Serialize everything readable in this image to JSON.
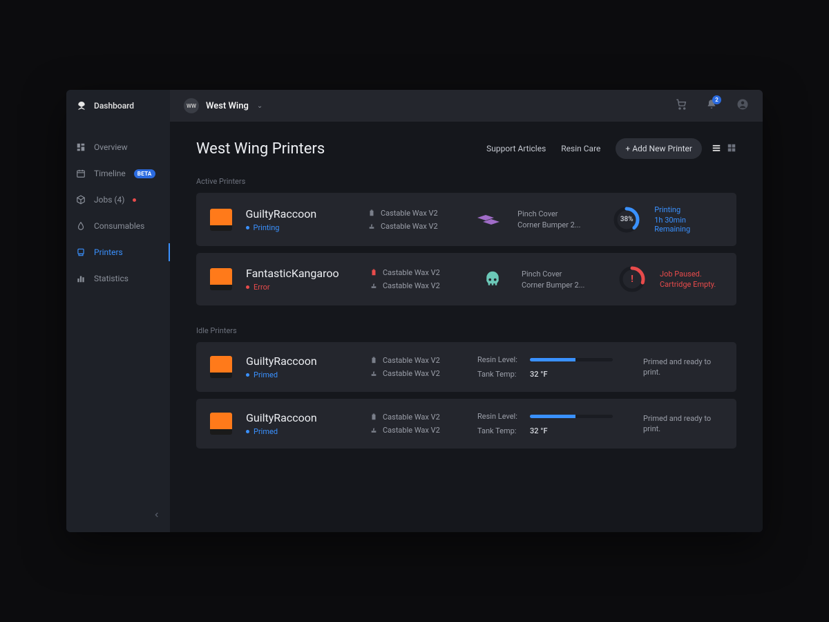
{
  "sidebar": {
    "title": "Dashboard",
    "items": [
      {
        "label": "Overview"
      },
      {
        "label": "Timeline",
        "badge": "BETA"
      },
      {
        "label": "Jobs (4)",
        "dot": true
      },
      {
        "label": "Consumables"
      },
      {
        "label": "Printers"
      },
      {
        "label": "Statistics"
      }
    ]
  },
  "topbar": {
    "org_initials": "WW",
    "org_name": "West Wing",
    "notif_count": "2"
  },
  "header": {
    "title": "West Wing Printers",
    "links": {
      "support": "Support Articles",
      "care": "Resin Care"
    },
    "add_btn": "+ Add New Printer"
  },
  "sections": {
    "active_label": "Active Printers",
    "idle_label": "Idle Printers"
  },
  "active": [
    {
      "name": "GuiltyRaccoon",
      "status": "Printing",
      "status_class": "printing",
      "mat1": "Castable Wax V2",
      "mat2": "Castable Wax V2",
      "mat1_red": false,
      "file1": "Pinch Cover",
      "file2": "Corner Bumper 2...",
      "model_color": "#a06cc8",
      "model_type": "blocks",
      "progress_pct": 38,
      "progress_label": "38%",
      "job_l1": "Printing",
      "job_l2": "1h 30min Remaining",
      "error": false
    },
    {
      "name": "FantasticKangaroo",
      "status": "Error",
      "status_class": "error",
      "mat1": "Castable Wax V2",
      "mat2": "Castable Wax V2",
      "mat1_red": true,
      "file1": "Pinch Cover",
      "file2": "Corner Bumper 2...",
      "model_color": "#6cc8b8",
      "model_type": "skull",
      "progress_pct": 30,
      "progress_label": "!",
      "job_l1": "Job Paused.",
      "job_l2": "Cartridge Empty.",
      "error": true
    }
  ],
  "idle": [
    {
      "name": "GuiltyRaccoon",
      "status": "Primed",
      "mat1": "Castable Wax V2",
      "mat2": "Castable Wax V2",
      "resin_label": "Resin Level:",
      "resin_pct": 55,
      "temp_label": "Tank Temp:",
      "temp_value": "32 °F",
      "msg": "Primed and ready to print."
    },
    {
      "name": "GuiltyRaccoon",
      "status": "Primed",
      "mat1": "Castable Wax V2",
      "mat2": "Castable Wax V2",
      "resin_label": "Resin Level:",
      "resin_pct": 55,
      "temp_label": "Tank Temp:",
      "temp_value": "32 °F",
      "msg": "Primed and ready to print."
    }
  ]
}
